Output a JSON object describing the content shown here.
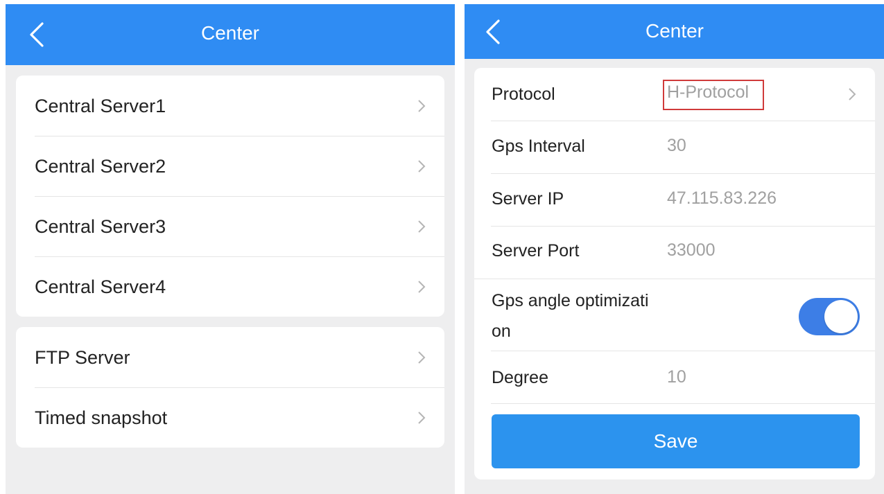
{
  "left_screen": {
    "title": "Center",
    "server_items": [
      {
        "label": "Central Server1"
      },
      {
        "label": "Central Server2"
      },
      {
        "label": "Central Server3"
      },
      {
        "label": "Central Server4"
      }
    ],
    "other_items": [
      {
        "label": "FTP Server"
      },
      {
        "label": "Timed snapshot"
      }
    ]
  },
  "right_screen": {
    "title": "Center",
    "protocol": {
      "label": "Protocol",
      "value": "H-Protocol"
    },
    "gps_interval": {
      "label": "Gps Interval",
      "value": "30"
    },
    "server_ip": {
      "label": "Server IP",
      "value": "47.115.83.226"
    },
    "server_port": {
      "label": "Server Port",
      "value": "33000"
    },
    "gps_angle": {
      "label_line1": "Gps angle optimizati",
      "label_line2": "on",
      "enabled": true
    },
    "degree": {
      "label": "Degree",
      "value": "10"
    },
    "save_label": "Save"
  },
  "icons": {
    "back": "chevron-left-icon",
    "row_arrow": "chevron-right-icon"
  },
  "colors": {
    "header": "#2f8cf3",
    "toggle_on": "#3d7ee6",
    "save_button": "#2c93ee",
    "highlight_box": "#d03a3a",
    "background": "#eeeeef"
  }
}
